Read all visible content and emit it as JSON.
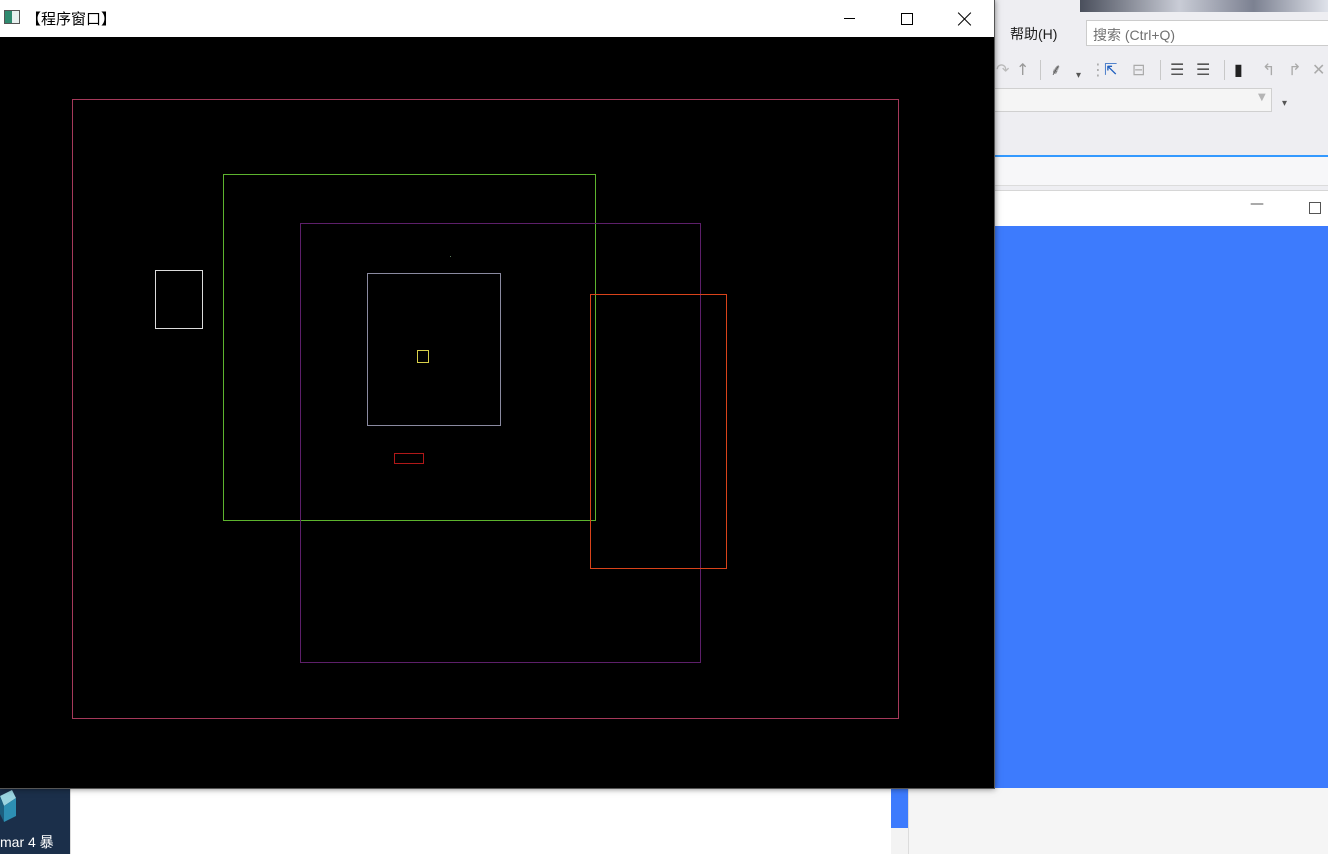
{
  "program_window": {
    "title": "【程序窗口】",
    "rectangles": [
      {
        "id": "outer",
        "color": "#a5395a"
      },
      {
        "id": "green",
        "color": "#5db32e"
      },
      {
        "id": "purple",
        "color": "#5d1f6a"
      },
      {
        "id": "gray",
        "color": "#8a8aa0"
      },
      {
        "id": "white-small",
        "color": "#dcdcdc"
      },
      {
        "id": "yellow-tiny",
        "color": "#d8d04a"
      },
      {
        "id": "red-small",
        "color": "#b01818"
      },
      {
        "id": "orange",
        "color": "#d9431a"
      }
    ]
  },
  "ide": {
    "menu_help": "帮助(H)",
    "search_placeholder": "搜索 (Ctrl+Q)"
  },
  "taskbar": {
    "label": "mar 4  暴"
  },
  "colors": {
    "canvas_bg": "#000000",
    "accent_blue": "#3d7bfd"
  }
}
